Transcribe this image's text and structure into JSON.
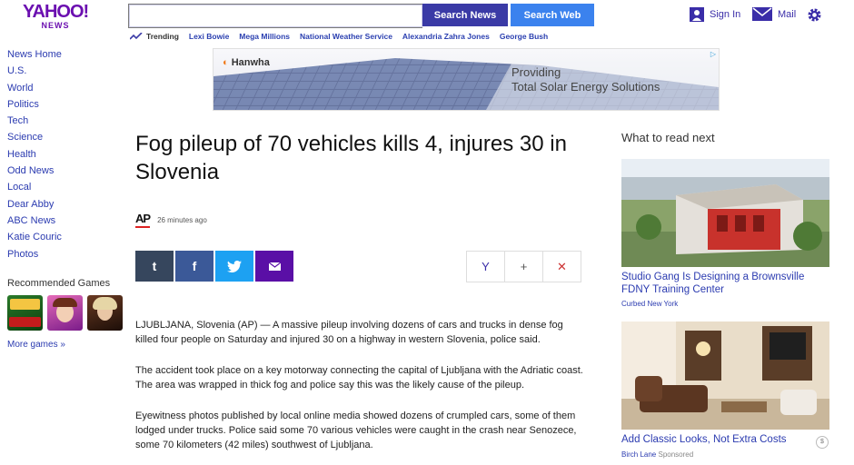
{
  "header": {
    "logo_text": "YAHOO!",
    "logo_sub": "NEWS",
    "search_value": "",
    "search_news_label": "Search News",
    "search_web_label": "Search Web",
    "signin_label": "Sign In",
    "mail_label": "Mail",
    "trending_label": "Trending",
    "trending": [
      "Lexi Bowie",
      "Mega Millions",
      "National Weather Service",
      "Alexandria Zahra Jones",
      "George Bush"
    ]
  },
  "sidebar": {
    "items": [
      "News Home",
      "U.S.",
      "World",
      "Politics",
      "Tech",
      "Science",
      "Health",
      "Odd News",
      "Local",
      "Dear Abby",
      "ABC News",
      "Katie Couric",
      "Photos"
    ],
    "recommended_title": "Recommended Games",
    "more_games": "More games »"
  },
  "ad": {
    "brand": "Hanwha",
    "line1": "Providing",
    "line2": "Total Solar Energy Solutions",
    "adchoice": "▷"
  },
  "article": {
    "headline": "Fog pileup of 70 vehicles kills 4, injures 30 in Slovenia",
    "source": "AP",
    "time": "26 minutes ago",
    "share": [
      "t",
      "f",
      "🐦",
      "✉"
    ],
    "tools": [
      "Y",
      "+",
      "✕"
    ],
    "paragraphs": [
      "LJUBLJANA, Slovenia (AP) — A massive pileup involving dozens of cars and trucks in dense fog killed four people on Saturday and injured 30 on a highway in western Slovenia, police said.",
      "The accident took place on a key motorway connecting the capital of Ljubljana with the Adriatic coast. The area was wrapped in thick fog and police say this was the likely cause of the pileup.",
      "Eyewitness photos published by local online media showed dozens of crumpled cars, some of them lodged under trucks. Police said some 70 various vehicles were caught in the crash near Senozece, some 70 kilometers (42 miles) southwest of Ljubljana."
    ]
  },
  "rail": {
    "title": "What to read next",
    "cards": [
      {
        "title": "Studio Gang Is Designing a Brownsville FDNY Training Center",
        "source": "Curbed New York",
        "sponsored": ""
      },
      {
        "title": "Add Classic Looks, Not Extra Costs",
        "source": "Birch Lane",
        "sponsored": "Sponsored"
      }
    ]
  },
  "colors": {
    "brand": "#6b0fb0",
    "link": "#2b3bb0",
    "search_news": "#3a3aa6",
    "search_web": "#3b82ee",
    "tumblr": "#36465d",
    "facebook": "#3b5998",
    "twitter": "#1da1f2",
    "mail": "#5a0fa6"
  }
}
